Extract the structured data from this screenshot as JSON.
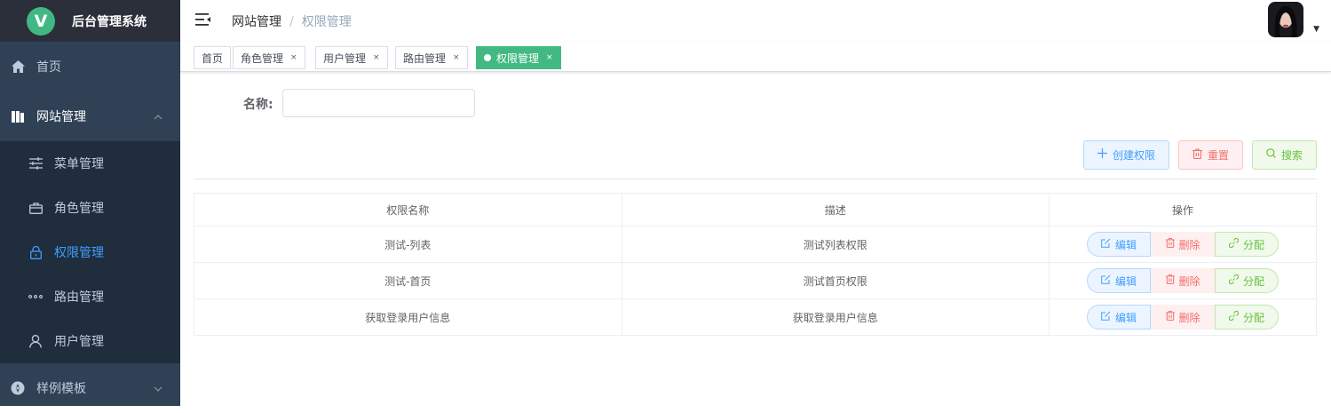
{
  "app": {
    "logo_letter": "V",
    "title": "后台管理系统"
  },
  "sidebar": {
    "home": "首页",
    "group": "网站管理",
    "items": [
      {
        "label": "菜单管理",
        "icon": "sliders-icon"
      },
      {
        "label": "角色管理",
        "icon": "briefcase-icon"
      },
      {
        "label": "权限管理",
        "icon": "lock-icon"
      },
      {
        "label": "路由管理",
        "icon": "more-dots-icon"
      },
      {
        "label": "用户管理",
        "icon": "user-icon"
      }
    ],
    "group2": "样例模板"
  },
  "header": {
    "breadcrumb": [
      "网站管理",
      "权限管理"
    ],
    "separator": "/",
    "avatar_caret": "▼"
  },
  "tags": [
    {
      "label": "首页"
    },
    {
      "label": "角色管理",
      "close": "×"
    },
    {
      "label": "用户管理",
      "close": "×"
    },
    {
      "label": "路由管理",
      "close": "×"
    },
    {
      "label": "权限管理",
      "close": "×"
    }
  ],
  "form": {
    "name_label": "名称:",
    "name_value": ""
  },
  "buttons": {
    "create": "创建权限",
    "reset": "重置",
    "search": "搜索"
  },
  "table": {
    "headers": [
      "权限名称",
      "描述",
      "操作"
    ],
    "rows": [
      {
        "name": "测试-列表",
        "desc": "测试列表权限"
      },
      {
        "name": "测试-首页",
        "desc": "测试首页权限"
      },
      {
        "name": "获取登录用户信息",
        "desc": "获取登录用户信息"
      }
    ],
    "actions": {
      "edit": "编辑",
      "delete": "删除",
      "assign": "分配"
    }
  },
  "colors": {
    "sidebar_bg": "#304156",
    "sidebar_active": "#409eff",
    "tag_active": "#42b983",
    "primary": "#409eff",
    "danger": "#f56c6c",
    "success": "#67c23a"
  }
}
